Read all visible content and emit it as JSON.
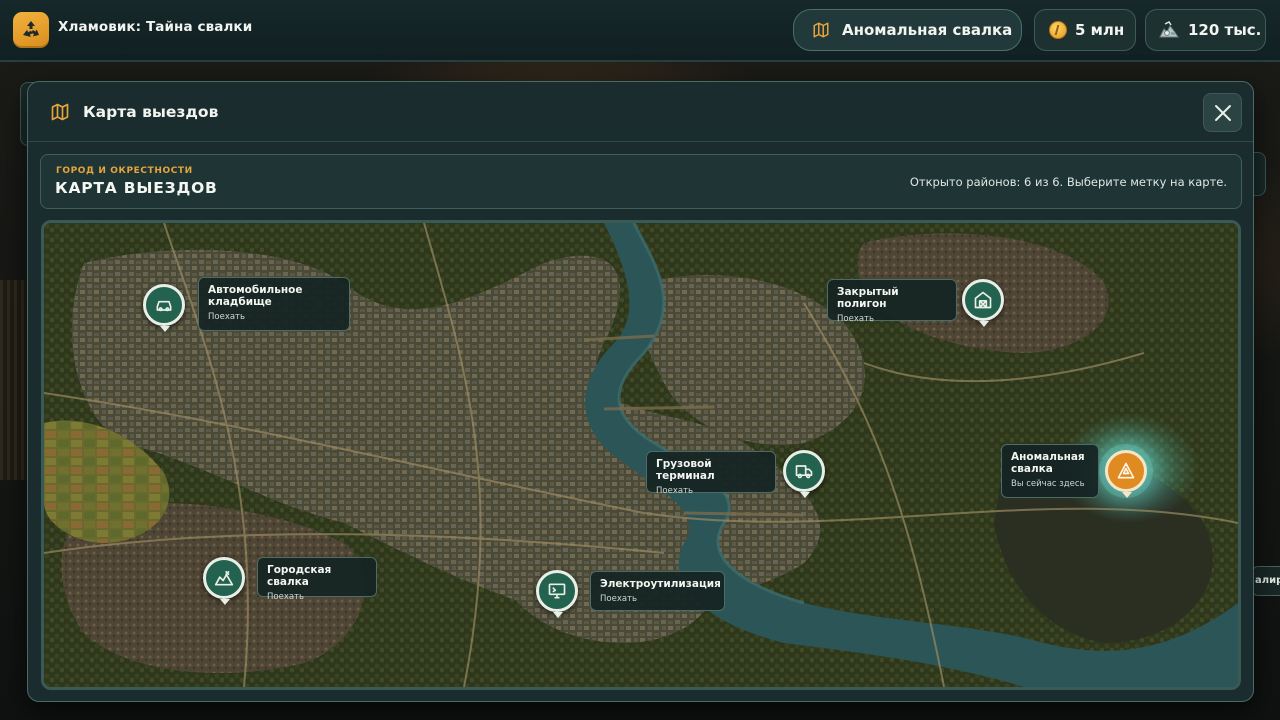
{
  "app": {
    "title": "Хламовик: Тайна свалки",
    "icon": "recycle-arrows-icon"
  },
  "topbar": {
    "location_label": "Аномальная свалка",
    "location_icon": "map-icon",
    "coins_label": "5 млн",
    "coins_icon": "coin-icon",
    "scrap_label": "120 тыс.",
    "scrap_icon": "scrap-pile-icon"
  },
  "background": {
    "right_strip_text": "алиро"
  },
  "modal": {
    "title": "Карта выездов",
    "title_icon": "map-icon",
    "close_icon": "close-icon",
    "info": {
      "kicker": "ГОРОД И ОКРЕСТНОСТИ",
      "heading": "КАРТА ВЫЕЗДОВ",
      "status": "Открыто районов: 6 из 6. Выберите метку на карте."
    }
  },
  "map": {
    "locations": [
      {
        "name": "Автомобильное кладбище",
        "action": "Поехать",
        "icon": "car-icon",
        "current": false
      },
      {
        "name": "Закрытый полигон",
        "action": "Поехать",
        "icon": "barn-icon",
        "current": false
      },
      {
        "name": "Грузовой терминал",
        "action": "Поехать",
        "icon": "truck-icon",
        "current": false
      },
      {
        "name": "Аномальная свалка",
        "action": "Вы сейчас здесь",
        "icon": "anomaly-icon",
        "current": true
      },
      {
        "name": "Городская свалка",
        "action": "Поехать",
        "icon": "junk-pile-icon",
        "current": false
      },
      {
        "name": "Электроутилизация",
        "action": "Поехать",
        "icon": "monitor-icon",
        "current": false
      }
    ]
  },
  "colors": {
    "accent": "#e6a53a",
    "marker": "#246250",
    "marker_current": "#e08a22",
    "panel": "#1a2c2d"
  }
}
